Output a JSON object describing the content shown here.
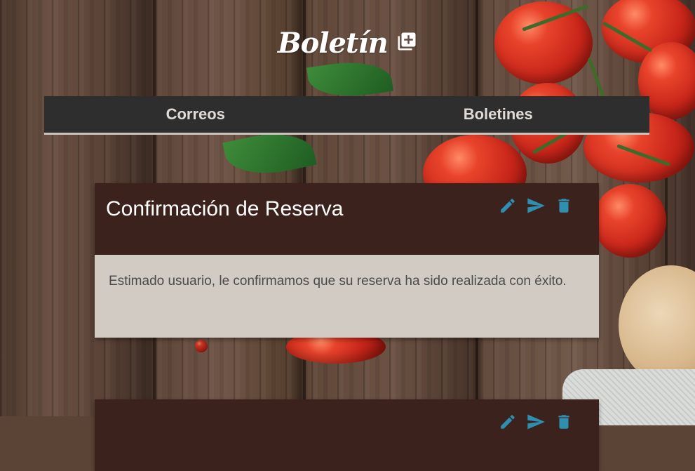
{
  "brand": {
    "title": "Boletín",
    "icon": "add-library-icon"
  },
  "nav": {
    "tabs": [
      {
        "label": "Correos"
      },
      {
        "label": "Boletines"
      }
    ]
  },
  "cards": [
    {
      "title": "Confirmación de Reserva",
      "body": "Estimado usuario, le confirmamos que su reserva ha sido realizada con éxito.",
      "actions": [
        "edit-icon",
        "send-icon",
        "delete-icon"
      ]
    },
    {
      "title": "",
      "body": "",
      "actions": [
        "edit-icon",
        "send-icon",
        "delete-icon"
      ]
    }
  ],
  "colors": {
    "accent": "#2f8fb1",
    "card_header": "#3b221d",
    "card_body": "#d2cbc4",
    "nav_bg": "#2e2e2e"
  }
}
